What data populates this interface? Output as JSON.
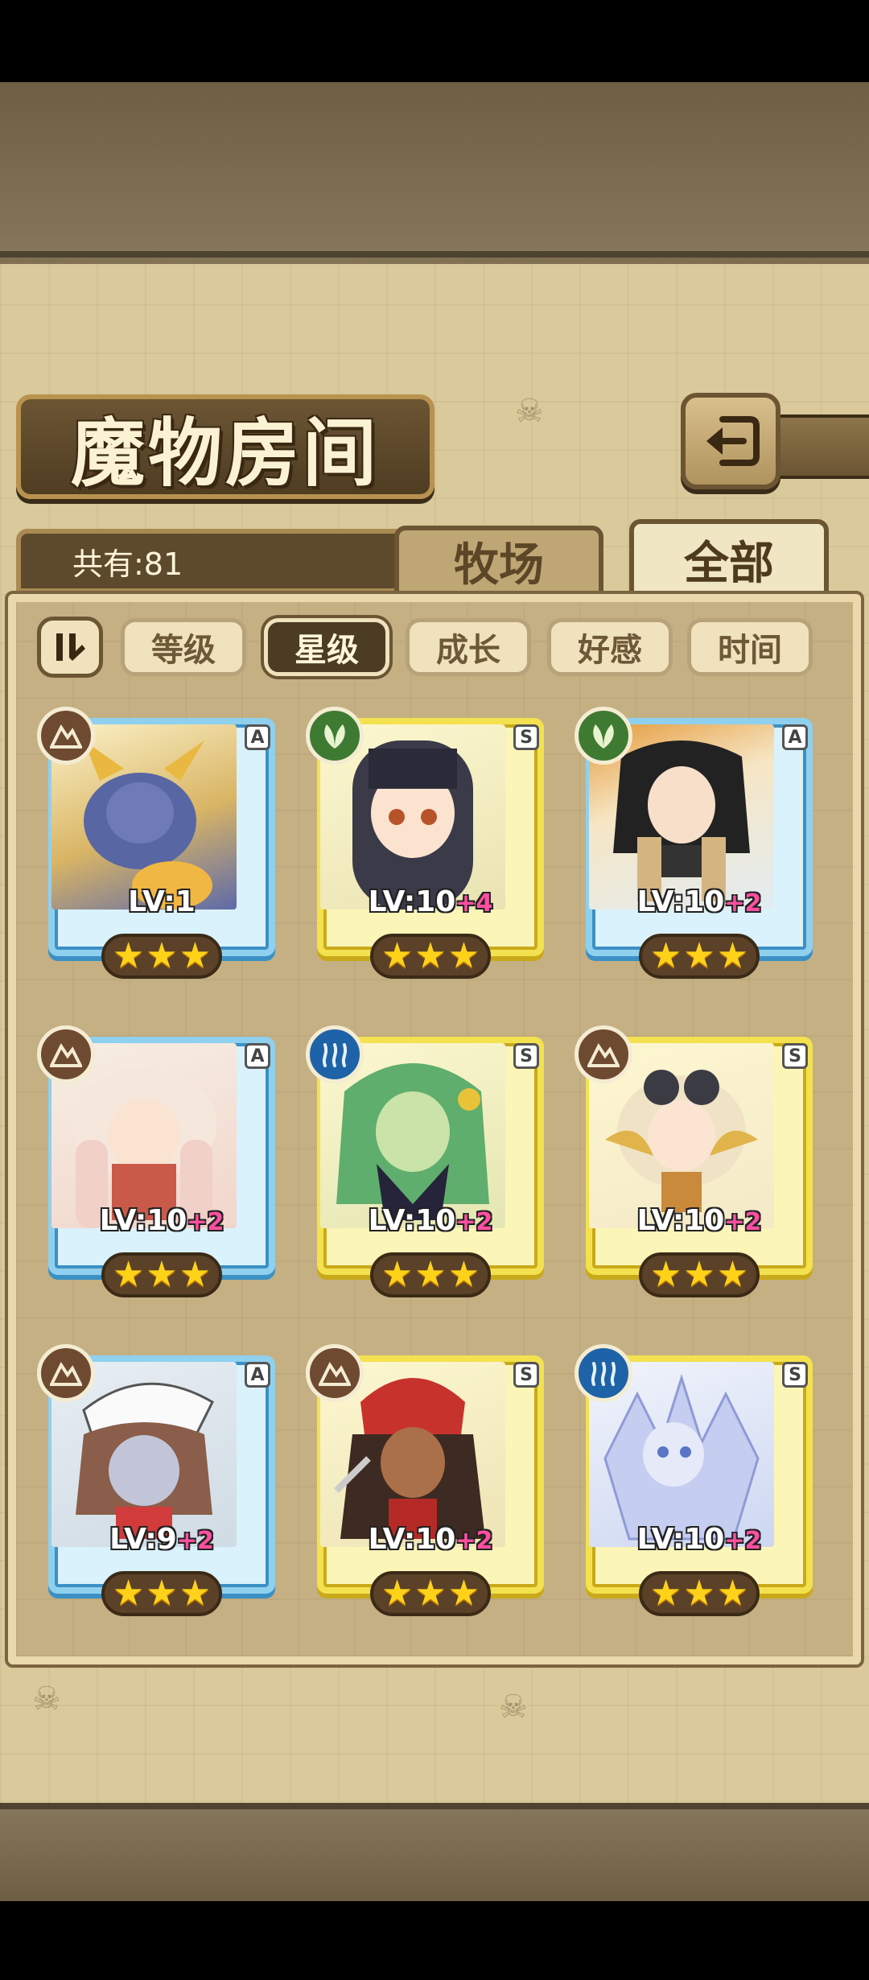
{
  "header": {
    "title": "魔物房间"
  },
  "summary": {
    "count_label": "共有:81"
  },
  "tabs": [
    {
      "label": "牧场",
      "active": false
    },
    {
      "label": "全部",
      "active": true
    }
  ],
  "sort": {
    "buttons": [
      {
        "label": "等级",
        "active": false
      },
      {
        "label": "星级",
        "active": true
      },
      {
        "label": "成长",
        "active": false
      },
      {
        "label": "好感",
        "active": false
      },
      {
        "label": "时间",
        "active": false
      }
    ]
  },
  "cards": [
    {
      "rank": "A",
      "element": "earth-icon",
      "lv": "LV:1",
      "plus": "",
      "stars": 3
    },
    {
      "rank": "S",
      "element": "leaf-icon",
      "lv": "LV:10",
      "plus": "+4",
      "stars": 3
    },
    {
      "rank": "A",
      "element": "leaf-icon",
      "lv": "LV:10",
      "plus": "+2",
      "stars": 3
    },
    {
      "rank": "A",
      "element": "earth-icon",
      "lv": "LV:10",
      "plus": "+2",
      "stars": 3
    },
    {
      "rank": "S",
      "element": "water-icon",
      "lv": "LV:10",
      "plus": "+2",
      "stars": 3
    },
    {
      "rank": "S",
      "element": "earth-icon",
      "lv": "LV:10",
      "plus": "+2",
      "stars": 3
    },
    {
      "rank": "A",
      "element": "earth-icon",
      "lv": "LV:9",
      "plus": "+2",
      "stars": 3
    },
    {
      "rank": "S",
      "element": "earth-icon",
      "lv": "LV:10",
      "plus": "+2",
      "stars": 3
    },
    {
      "rank": "S",
      "element": "water-icon",
      "lv": "LV:10",
      "plus": "+2",
      "stars": 3
    }
  ]
}
